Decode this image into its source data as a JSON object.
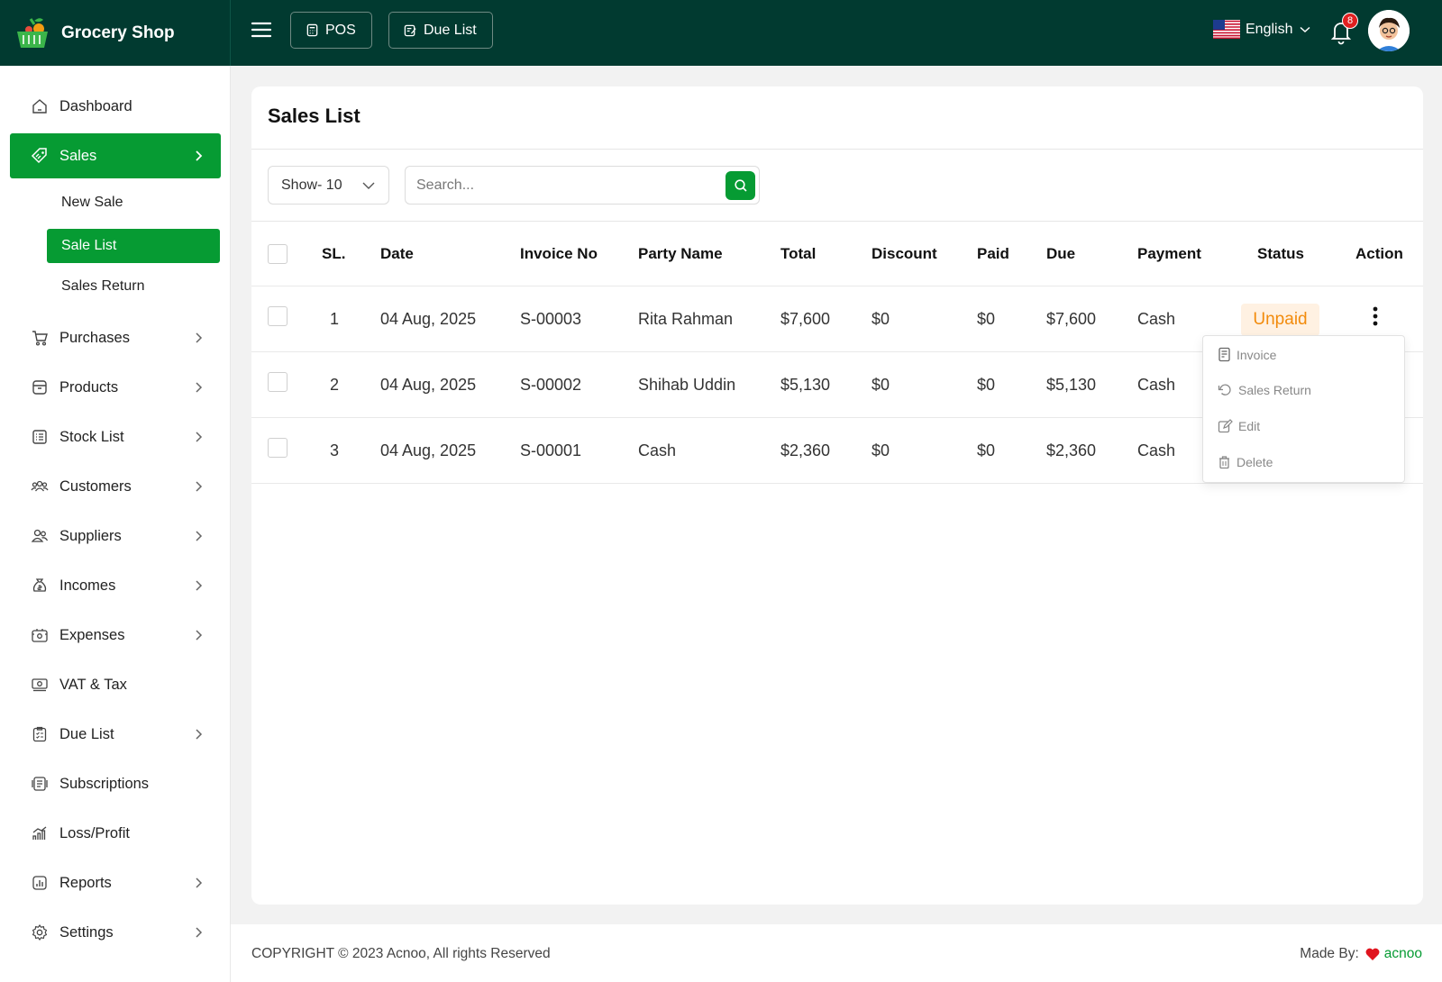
{
  "app": {
    "title": "Grocery Shop"
  },
  "header": {
    "pos_label": "POS",
    "due_list_label": "Due List",
    "language": "English",
    "notification_count": "8"
  },
  "sidebar": {
    "items": [
      {
        "label": "Dashboard"
      },
      {
        "label": "Sales"
      },
      {
        "label": "New Sale"
      },
      {
        "label": "Sale List"
      },
      {
        "label": "Sales Return"
      },
      {
        "label": "Purchases"
      },
      {
        "label": "Products"
      },
      {
        "label": "Stock List"
      },
      {
        "label": "Customers"
      },
      {
        "label": "Suppliers"
      },
      {
        "label": "Incomes"
      },
      {
        "label": "Expenses"
      },
      {
        "label": "VAT & Tax"
      },
      {
        "label": "Due List"
      },
      {
        "label": "Subscriptions"
      },
      {
        "label": "Loss/Profit"
      },
      {
        "label": "Reports"
      },
      {
        "label": "Settings"
      }
    ]
  },
  "main": {
    "title": "Sales List",
    "show_select": "Show- 10",
    "search_placeholder": "Search...",
    "columns": [
      "SL.",
      "Date",
      "Invoice No",
      "Party Name",
      "Total",
      "Discount",
      "Paid",
      "Due",
      "Payment",
      "Status",
      "Action"
    ],
    "rows": [
      {
        "sl": "1",
        "date": "04 Aug, 2025",
        "invoice": "S-00003",
        "party": "Rita Rahman",
        "total": "$7,600",
        "discount": "$0",
        "paid": "$0",
        "due": "$7,600",
        "payment": "Cash",
        "status": "Unpaid"
      },
      {
        "sl": "2",
        "date": "04 Aug, 2025",
        "invoice": "S-00002",
        "party": "Shihab Uddin",
        "total": "$5,130",
        "discount": "$0",
        "paid": "$0",
        "due": "$5,130",
        "payment": "Cash"
      },
      {
        "sl": "3",
        "date": "04 Aug, 2025",
        "invoice": "S-00001",
        "party": "Cash",
        "total": "$2,360",
        "discount": "$0",
        "paid": "$0",
        "due": "$2,360",
        "payment": "Cash"
      }
    ],
    "action_menu": [
      "Invoice",
      "Sales Return",
      "Edit",
      "Delete"
    ]
  },
  "footer": {
    "copyright": "COPYRIGHT © 2023 Acnoo, All rights Reserved",
    "made_by": "Made By:",
    "brand": "acnoo"
  },
  "colors": {
    "primary": "#069b33",
    "header": "#013a30",
    "unpaid": "#f28b0c"
  }
}
